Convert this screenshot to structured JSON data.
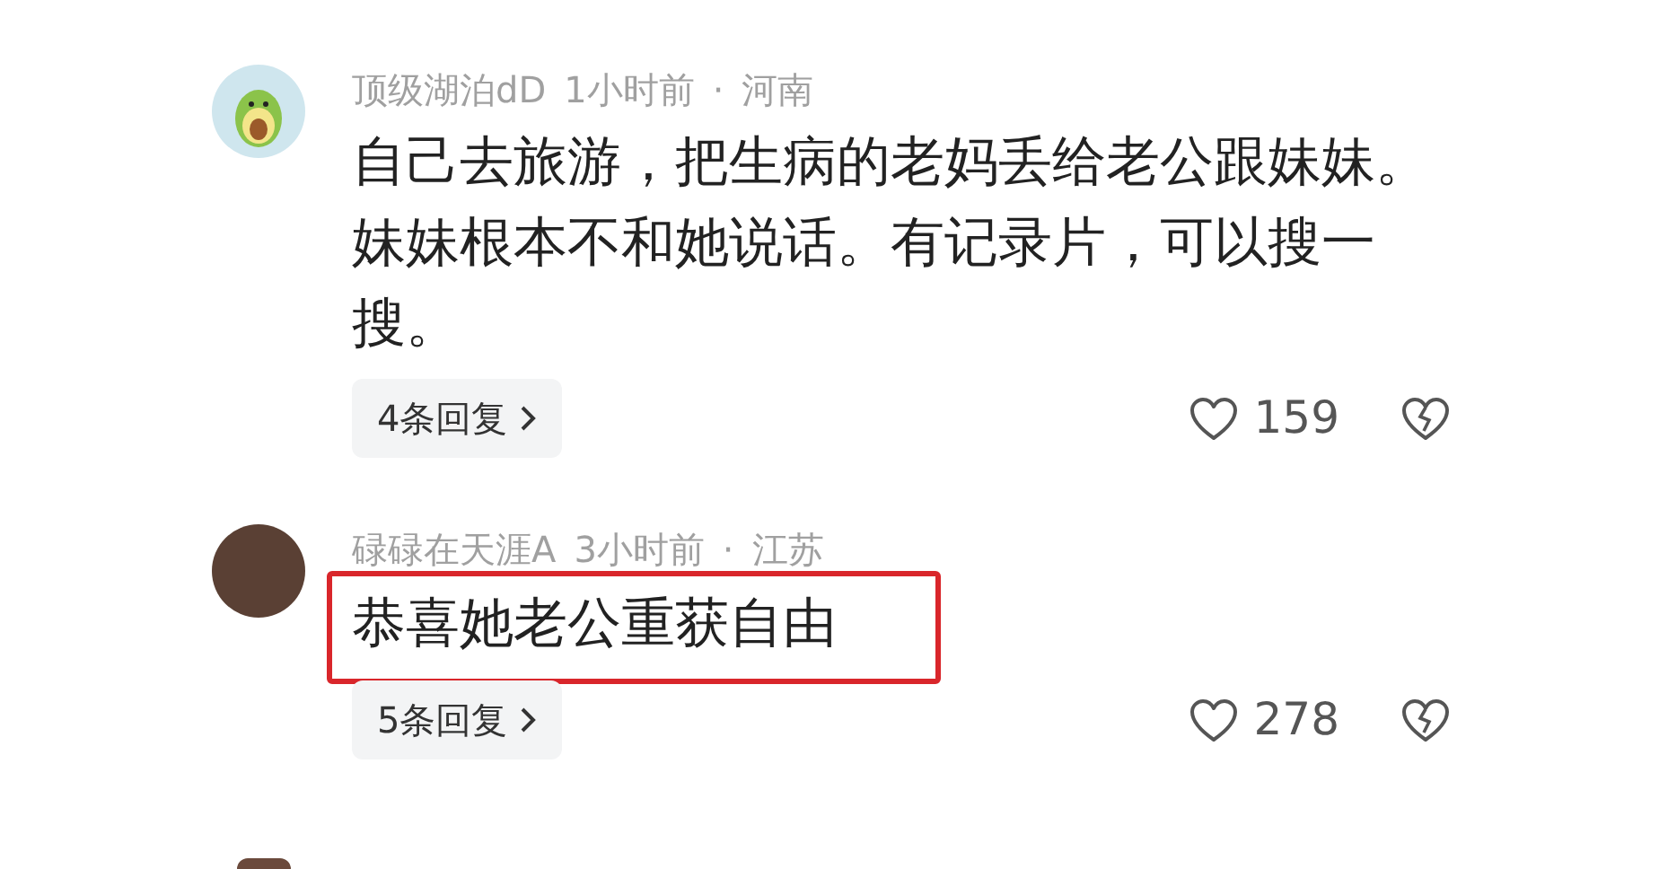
{
  "comments": [
    {
      "kind": "cartoon",
      "author": "顶级湖泊dD",
      "time": "1小时前",
      "dot": "·",
      "location": "河南",
      "text": "自己去旅游，把生病的老妈丢给老公跟妹妹。妹妹根本不和她说话。有记录片，可以搜一搜。",
      "replies": "4条回复",
      "likes": "159",
      "highlighted": false
    },
    {
      "kind": "photo",
      "author": "碌碌在天涯A",
      "time": "3小时前",
      "dot": "·",
      "location": "江苏",
      "text": "恭喜她老公重获自由",
      "replies": "5条回复",
      "likes": "278",
      "highlighted": true
    }
  ]
}
